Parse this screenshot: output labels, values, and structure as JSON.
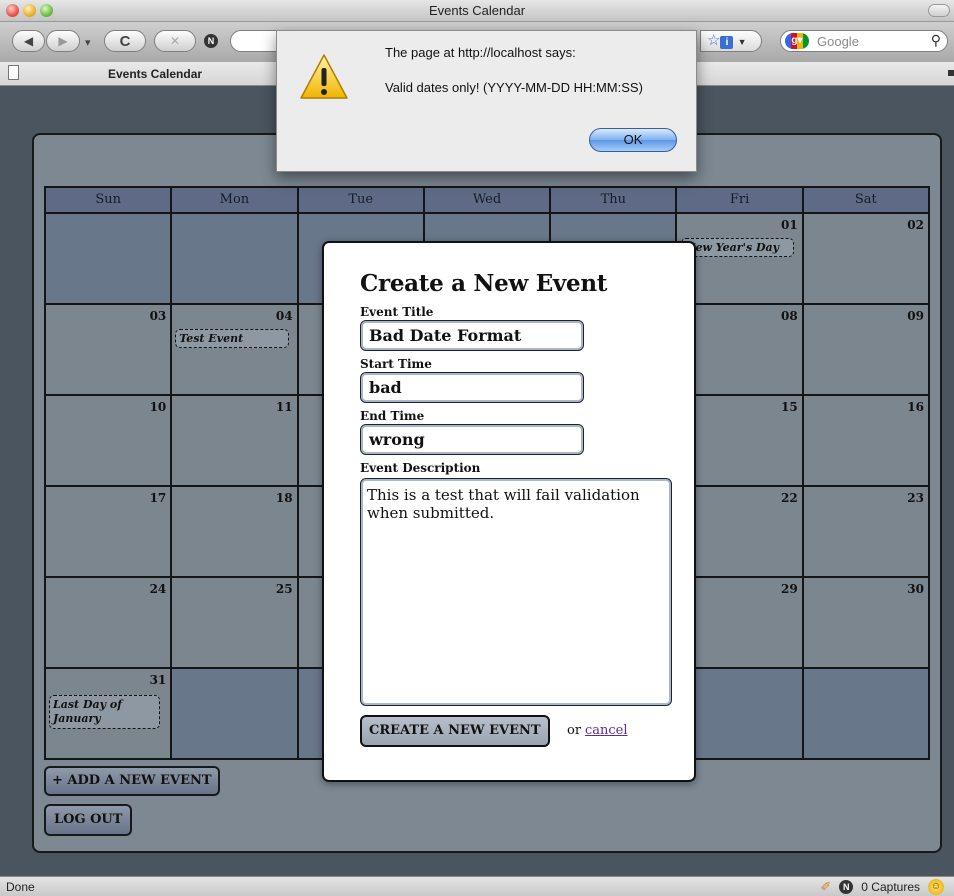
{
  "window": {
    "title": "Events Calendar"
  },
  "toolbar": {
    "reload_glyph": "C",
    "stop_glyph": "✕",
    "search_placeholder": "Google"
  },
  "tab": {
    "label": "Events Calendar"
  },
  "status": {
    "left": "Done",
    "captures": "0 Captures"
  },
  "calendar": {
    "weekdays": [
      "Sun",
      "Mon",
      "Tue",
      "Wed",
      "Thu",
      "Fri",
      "Sat"
    ],
    "days": {
      "d01": "01",
      "d02": "02",
      "d03": "03",
      "d04": "04",
      "d08": "08",
      "d09": "09",
      "d10": "10",
      "d11": "11",
      "d15": "15",
      "d16": "16",
      "d17": "17",
      "d18": "18",
      "d22": "22",
      "d23": "23",
      "d24": "24",
      "d25": "25",
      "d29": "29",
      "d30": "30",
      "d31": "31"
    },
    "events": {
      "new_years": "New Year's Day",
      "test_event": "Test Event",
      "last_day": "Last Day of January"
    }
  },
  "page_buttons": {
    "add_event": "+ ADD A NEW EVENT",
    "logout": "LOG OUT"
  },
  "modal": {
    "title": "Create a New Event",
    "event_title_label": "Event Title",
    "event_title_value": "Bad Date Format",
    "start_label": "Start Time",
    "start_value": "bad",
    "end_label": "End Time",
    "end_value": "wrong",
    "description_label": "Event Description",
    "description_value": "This is a test that will fail validation when submitted.",
    "submit_label": "CREATE A NEW EVENT",
    "or_text": "or",
    "cancel_label": "cancel"
  },
  "alert": {
    "heading": "The page at http://localhost says:",
    "message": "Valid dates only! (YYYY-MM-DD HH:MM:SS)",
    "ok_label": "OK"
  },
  "colors": {
    "link": "#5b2c9e",
    "calendar_header": "#5f6b86",
    "overlay": "#4b5560"
  }
}
